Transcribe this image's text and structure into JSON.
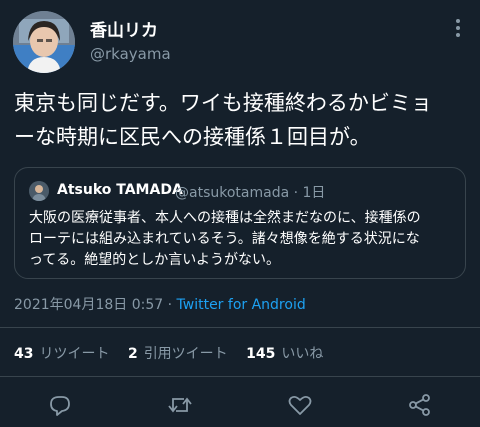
{
  "author": {
    "display_name": "香山リカ",
    "handle": "@rkayama"
  },
  "tweet": {
    "text": "東京も同じだす。ワイも接種終わるかビミョ\nーな時期に区民への接種係１回目が。"
  },
  "quoted_tweet": {
    "display_name": "Atsuko TAMADA",
    "handle_time": "@atsukotamada · 1日",
    "text": "大阪の医療従事者、本人への接種は全然まだなのに、接種係の\nローテには組み込まれているそう。諸々想像を絶する状況にな\nってる。絶望的としか言いようがない。"
  },
  "meta": {
    "timestamp": "2021年04月18日 0:57",
    "separator": " · ",
    "source": "Twitter for Android"
  },
  "stats": {
    "retweets_count": "43",
    "retweets_label": "リツイート",
    "quotes_count": "2",
    "quotes_label": "引用ツイート",
    "likes_count": "145",
    "likes_label": "いいね"
  },
  "icons": {
    "more": "more-vertical-icon",
    "reply": "reply-icon",
    "retweet": "retweet-icon",
    "like": "heart-icon",
    "share": "share-icon"
  },
  "colors": {
    "background": "#15202b",
    "secondary_text": "#8899a6",
    "link": "#1da1f2",
    "border": "#38444d"
  }
}
